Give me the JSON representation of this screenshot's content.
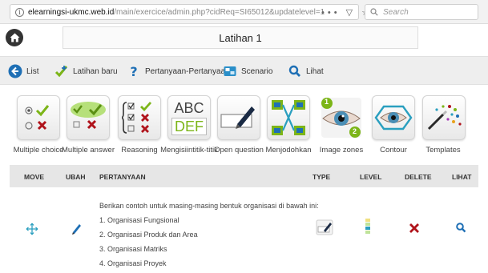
{
  "browser": {
    "url_host": "elearningsi-ukmc.web.id",
    "url_path": "/main/exercice/admin.php?cidReq=SI65012&updatelevel=1",
    "search_placeholder": "Search"
  },
  "page": {
    "title": "Latihan 1"
  },
  "actions": [
    {
      "label": "List",
      "icon": "arrow-left-icon"
    },
    {
      "label": "Latihan baru",
      "icon": "new-exercise-icon"
    },
    {
      "label": "Pertanyaan-Pertanyaan",
      "icon": "question-icon"
    },
    {
      "label": "Scenario",
      "icon": "scenario-icon"
    },
    {
      "label": "Lihat",
      "icon": "preview-icon"
    }
  ],
  "question_types": [
    {
      "label": "Multiple choice",
      "icon": "multiple-choice-icon"
    },
    {
      "label": "Multiple answer",
      "icon": "multiple-answer-icon"
    },
    {
      "label": "Reasoning",
      "icon": "reasoning-icon"
    },
    {
      "label": "Mengisiintitik-titik",
      "icon": "fill-blanks-icon",
      "abc": "ABC",
      "def": "DEF"
    },
    {
      "label": "Open question",
      "icon": "open-question-icon"
    },
    {
      "label": "Menjodohkan",
      "icon": "matching-icon"
    },
    {
      "label": "Image zones",
      "icon": "image-zones-icon",
      "badge1": "1",
      "badge2": "2"
    },
    {
      "label": "Contour",
      "icon": "contour-icon"
    },
    {
      "label": "Templates",
      "icon": "templates-icon"
    }
  ],
  "table": {
    "headers": {
      "move": "MOVE",
      "edit": "UBAH",
      "question": "PERTANYAAN",
      "type": "TYPE",
      "level": "LEVEL",
      "delete": "DELETE",
      "view": "LIHAT"
    },
    "rows": [
      {
        "question_lines": [
          "Berikan contoh untuk masing-masing bentuk organisasi di bawah ini:",
          "1. Organisasi Fungsional",
          "2. Organisasi Produk dan Area",
          "3. Organisasi Matriks",
          "4. Organisasi Proyek"
        ]
      }
    ]
  },
  "colors": {
    "accent_blue": "#1e6fb5",
    "check_green": "#7cb518",
    "cross_red": "#b0141c",
    "teal": "#2a9fbf"
  }
}
